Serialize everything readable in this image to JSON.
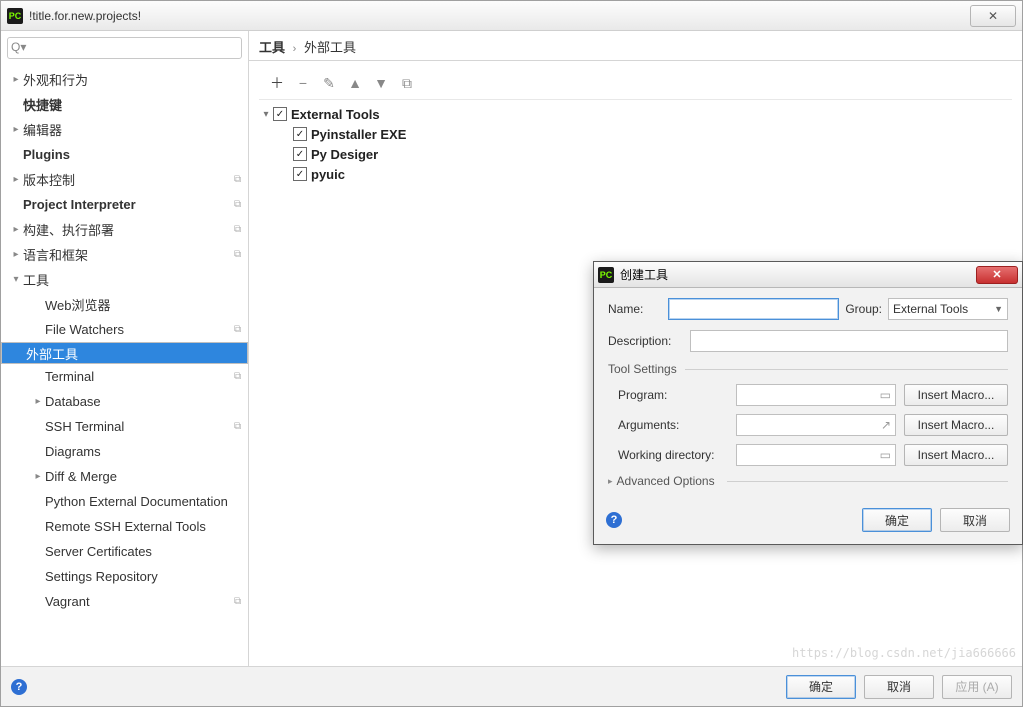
{
  "window": {
    "title": "!title.for.new.projects!",
    "close_glyph": "✕"
  },
  "search": {
    "placeholder": "",
    "glyph": "Q▾"
  },
  "sidebar": [
    {
      "label": "外观和行为",
      "depth": 0,
      "expand": true,
      "bold": false,
      "arrow": false
    },
    {
      "label": "快捷键",
      "depth": 0,
      "expand": false,
      "bold": true,
      "arrow": false
    },
    {
      "label": "编辑器",
      "depth": 0,
      "expand": true,
      "bold": false,
      "arrow": false
    },
    {
      "label": "Plugins",
      "depth": 0,
      "expand": false,
      "bold": true,
      "arrow": false
    },
    {
      "label": "版本控制",
      "depth": 0,
      "expand": true,
      "bold": false,
      "arrow": true
    },
    {
      "label": "Project Interpreter",
      "depth": 0,
      "expand": false,
      "bold": true,
      "arrow": true
    },
    {
      "label": "构建、执行部署",
      "depth": 0,
      "expand": true,
      "bold": false,
      "arrow": true
    },
    {
      "label": "语言和框架",
      "depth": 0,
      "expand": true,
      "bold": false,
      "arrow": true
    },
    {
      "label": "工具",
      "depth": 0,
      "expand": true,
      "open": true,
      "bold": false,
      "arrow": false
    },
    {
      "label": "Web浏览器",
      "depth": 1,
      "expand": false,
      "bold": false,
      "arrow": false
    },
    {
      "label": "File Watchers",
      "depth": 1,
      "expand": false,
      "bold": false,
      "arrow": true
    },
    {
      "label": "外部工具",
      "depth": 1,
      "expand": false,
      "bold": false,
      "arrow": false,
      "selected": true
    },
    {
      "label": "Terminal",
      "depth": 1,
      "expand": false,
      "bold": false,
      "arrow": true
    },
    {
      "label": "Database",
      "depth": 1,
      "expand": true,
      "bold": false,
      "arrow": false
    },
    {
      "label": "SSH Terminal",
      "depth": 1,
      "expand": false,
      "bold": false,
      "arrow": true
    },
    {
      "label": "Diagrams",
      "depth": 1,
      "expand": false,
      "bold": false,
      "arrow": false
    },
    {
      "label": "Diff & Merge",
      "depth": 1,
      "expand": true,
      "bold": false,
      "arrow": false
    },
    {
      "label": "Python External Documentation",
      "depth": 1,
      "expand": false,
      "bold": false,
      "arrow": false
    },
    {
      "label": "Remote SSH External Tools",
      "depth": 1,
      "expand": false,
      "bold": false,
      "arrow": false
    },
    {
      "label": "Server Certificates",
      "depth": 1,
      "expand": false,
      "bold": false,
      "arrow": false
    },
    {
      "label": "Settings Repository",
      "depth": 1,
      "expand": false,
      "bold": false,
      "arrow": false
    },
    {
      "label": "Vagrant",
      "depth": 1,
      "expand": false,
      "bold": false,
      "arrow": true
    }
  ],
  "breadcrumbs": {
    "a": "工具",
    "sep": "›",
    "b": "外部工具"
  },
  "toolbar_icons": {
    "add": "＋",
    "remove": "−",
    "edit": "✎",
    "up": "▲",
    "down": "▼",
    "copy": "⧉"
  },
  "tool_list": {
    "root": {
      "label": "External Tools",
      "checked": true
    },
    "items": [
      {
        "label": "Pyinstaller EXE",
        "checked": true
      },
      {
        "label": "Py Desiger",
        "checked": true
      },
      {
        "label": "pyuic",
        "checked": true
      }
    ]
  },
  "dialog": {
    "title": "创建工具",
    "labels": {
      "name": "Name:",
      "group": "Group:",
      "group_value": "External Tools",
      "description": "Description:",
      "tool_settings": "Tool Settings",
      "program": "Program:",
      "arguments": "Arguments:",
      "working_dir": "Working directory:",
      "advanced": "Advanced Options",
      "insert_macro": "Insert Macro...",
      "ok": "确定",
      "cancel": "取消"
    }
  },
  "footer": {
    "ok": "确定",
    "cancel": "取消",
    "apply": "应用 (A)"
  },
  "watermark": "https://blog.csdn.net/jia666666"
}
